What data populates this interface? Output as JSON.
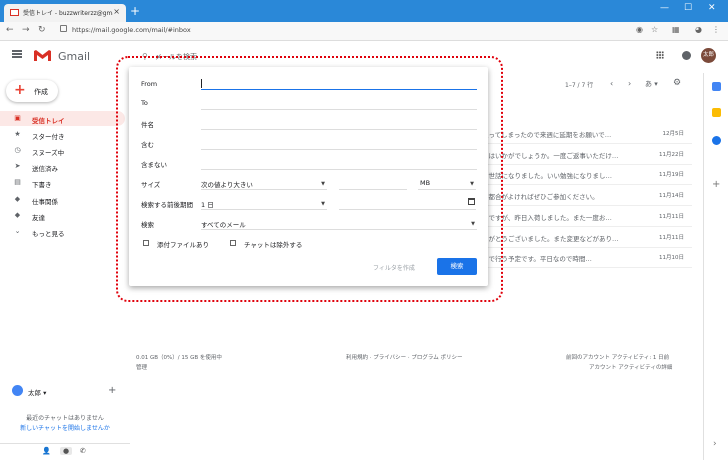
{
  "browser": {
    "tab_title": "受信トレイ - buzzwriterzz@gmail.com",
    "url": "https://mail.google.com/mail/#inbox",
    "new_tab": "+",
    "close": "×",
    "win_min": "—",
    "win_max": "☐",
    "win_close": "✕"
  },
  "header": {
    "app_name": "Gmail",
    "search_placeholder": "メールを検索",
    "avatar_text": "太郎"
  },
  "sidebar": {
    "compose": "作成",
    "items": [
      {
        "label": "受信トレイ",
        "icon": "inbox-icon",
        "glyph": "▣",
        "active": true
      },
      {
        "label": "スター付き",
        "icon": "star-icon",
        "glyph": "★",
        "active": false
      },
      {
        "label": "スヌーズ中",
        "icon": "clock-icon",
        "glyph": "◷",
        "active": false
      },
      {
        "label": "送信済み",
        "icon": "send-icon",
        "glyph": "➤",
        "active": false
      },
      {
        "label": "下書き",
        "icon": "draft-icon",
        "glyph": "▤",
        "active": false
      },
      {
        "label": "仕事関係",
        "icon": "label-icon",
        "glyph": "◆",
        "active": false
      },
      {
        "label": "友達",
        "icon": "label-icon",
        "glyph": "◆",
        "active": false
      },
      {
        "label": "もっと見る",
        "icon": "chevron-down-icon",
        "glyph": "⌄",
        "active": false
      }
    ]
  },
  "chat": {
    "user": "太郎 ▾",
    "no_chats": "最近のチャットはありません",
    "start_chat": "新しいチャットを開始しませんか"
  },
  "toolbar": {
    "pager": "1–7 / 7 行",
    "prev": "‹",
    "next": "›",
    "lang": "あ ▾",
    "gear": "⚙"
  },
  "emails": [
    {
      "snippet": "入ってしまったので来週に延期をお願いで…",
      "date": "12月5日"
    },
    {
      "snippet": "日はいかがでしょうか。一度ご返事いただけ…",
      "date": "11月22日"
    },
    {
      "snippet": "お世話になりました。いい勉強になりまし…",
      "date": "11月19日"
    },
    {
      "snippet": "ご都合がよければぜひご参加ください。",
      "date": "11月14日"
    },
    {
      "snippet": "品ですが、昨日入荷しました。また一度お…",
      "date": "11月11日"
    },
    {
      "snippet": "りがとうございました。また変更などがあり…",
      "date": "11月11日"
    },
    {
      "snippet": "ドで行う予定です。平日なので時間…",
      "date": "11月10日"
    }
  ],
  "footer": {
    "storage": "0.01 GB（0%）/ 15 GB を使用中",
    "manage": "管理",
    "policy": "利用規約 · プライバシー · プログラム ポリシー",
    "activity": "前回のアカウント アクティビティ: 1 日前",
    "details": "アカウント アクティビティの詳細"
  },
  "search_form": {
    "from": "From",
    "to": "To",
    "subject": "件名",
    "has_words": "含む",
    "not_words": "含まない",
    "size_label": "サイズ",
    "size_op": "次の値より大きい",
    "size_unit": "MB",
    "date_label": "検索する前後期間",
    "date_range": "1 日",
    "search_label": "検索",
    "search_in": "すべてのメール",
    "has_attachment": "添付ファイルあり",
    "exclude_chats": "チャットは除外する",
    "create_filter": "フィルタを作成",
    "search_button": "検索"
  }
}
